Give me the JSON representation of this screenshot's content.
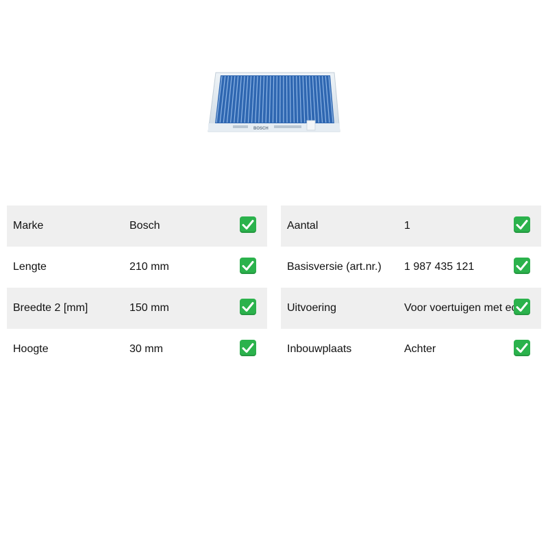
{
  "product_image": {
    "alt": "Bosch cabin air filter",
    "brand_text": "BOSCH",
    "filter_color": "#2f67b1",
    "frame_color": "#dfe8ef"
  },
  "specs_left": [
    {
      "label": "Marke",
      "value": "Bosch",
      "check": "check-icon"
    },
    {
      "label": "Lengte",
      "value": "210 mm",
      "check": "check-icon"
    },
    {
      "label": "Breedte 2 [mm]",
      "value": "150 mm",
      "check": "check-icon"
    },
    {
      "label": "Hoogte",
      "value": "30 mm",
      "check": "check-icon"
    }
  ],
  "specs_right": [
    {
      "label": "Aantal",
      "value": "1",
      "check": "check-icon"
    },
    {
      "label": "Basisversie (art.nr.)",
      "value": "1 987 435 121",
      "check": "check-icon"
    },
    {
      "label": "Uitvoering",
      "value": "Voor voertuigen met eco",
      "check": "check-icon"
    },
    {
      "label": "Inbouwplaats",
      "value": "Achter",
      "check": "check-icon"
    }
  ],
  "colors": {
    "row_shade": "#efefef",
    "check_green": "#2bb24c"
  }
}
